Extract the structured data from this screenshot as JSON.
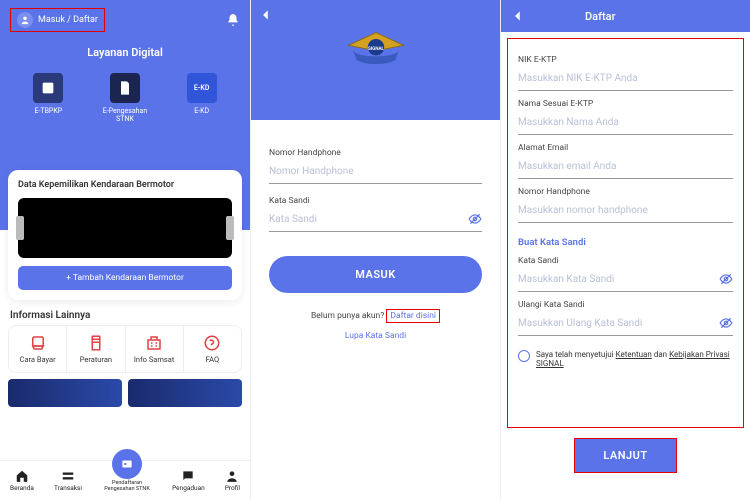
{
  "s1": {
    "login": "Masuk / Daftar",
    "heading": "Layanan Digital",
    "services": {
      "a": "E-TBPKP",
      "b": "E-Pengesahan STNK",
      "c": "E-KD"
    },
    "card_title": "Data Kepemilikan Kendaraan Bermotor",
    "add_btn": "+ Tambah Kendaraan Bermotor",
    "section": "Informasi Lainnya",
    "info": {
      "a": "Cara Bayar",
      "b": "Peraturan",
      "c": "Info Samsat",
      "d": "FAQ"
    },
    "tabs": {
      "a": "Beranda",
      "b": "Transaksi",
      "c": "Pendaftaran Pengesahan STNK",
      "d": "Pengaduan",
      "e": "Profil"
    }
  },
  "s2": {
    "f1_label": "Nomor Handphone",
    "f1_ph": "Nomor Handphone",
    "f2_label": "Kata Sandi",
    "f2_ph": "Kata Sandi",
    "btn": "MASUK",
    "noacct": "Belum punya akun? ",
    "register": "Daftar disini",
    "forgot": "Lupa Kata Sandi"
  },
  "s3": {
    "title": "Daftar",
    "f1": "NIK E-KTP",
    "p1": "Masukkan NIK E-KTP Anda",
    "f2": "Nama Sesuai E-KTP",
    "p2": "Masukkan Nama Anda",
    "f3": "Alamat Email",
    "p3": "Masukkan email Anda",
    "f4": "Nomor Handphone",
    "p4": "Masukkan nomor handphone",
    "sub": "Buat Kata Sandi",
    "f5": "Kata Sandi",
    "p5": "Masukkan Kata Sandi",
    "f6": "Ulangi Kata Sandi",
    "p6": "Masukkan Ulang Kata Sandi",
    "terms_a": "Saya telah menyetujui ",
    "terms_b": "Ketentuan",
    "terms_c": " dan ",
    "terms_d": "Kebijakan Privasi SIGNAL",
    "btn": "LANJUT"
  }
}
